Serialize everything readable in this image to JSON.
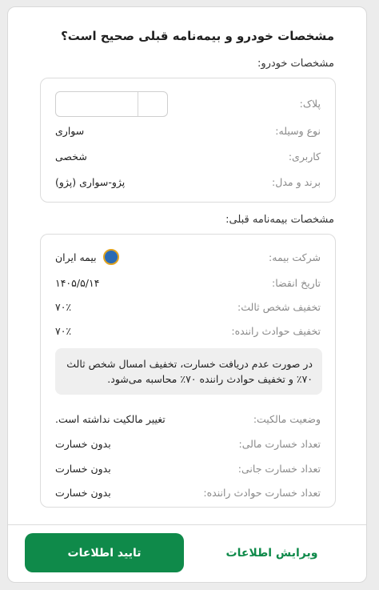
{
  "title": "مشخصات خودرو و بیمه‌نامه قبلی صحیح است؟",
  "vehicle": {
    "section_title": "مشخصات خودرو:",
    "plate_label": "پلاک:",
    "type_label": "نوع وسیله:",
    "type_value": "سواری",
    "usage_label": "کاربری:",
    "usage_value": "شخصی",
    "model_label": "برند و مدل:",
    "model_value": "پژو-سواری (پژو)"
  },
  "insurance": {
    "section_title": "مشخصات بیمه‌نامه قبلی:",
    "company_label": "شرکت بیمه:",
    "company_value": "بیمه ایران",
    "company_logo_icon": "iran-insurance-logo-icon",
    "expiry_label": "تاریخ انقضا:",
    "expiry_value": "۱۴۰۵/۵/۱۴",
    "third_party_discount_label": "تخفیف شخص ثالث:",
    "third_party_discount_value": "۷۰٪",
    "driver_discount_label": "تخفیف حوادث راننده:",
    "driver_discount_value": "۷۰٪",
    "notice": "در صورت عدم دریافت خسارت، تخفیف امسال شخص ثالث ۷۰٪ و تخفیف حوادث راننده ۷۰٪ محاسبه می‌شود.",
    "ownership_label": "وضعیت مالکیت:",
    "ownership_value": "تغییر مالکیت نداشته است.",
    "financial_claims_label": "تعداد خسارت مالی:",
    "financial_claims_value": "بدون خسارت",
    "bodily_claims_label": "تعداد خسارت جانی:",
    "bodily_claims_value": "بدون خسارت",
    "driver_claims_label": "تعداد خسارت حوادث راننده:",
    "driver_claims_value": "بدون خسارت"
  },
  "actions": {
    "confirm_label": "تایید اطلاعات",
    "edit_label": "ویرایش اطلاعات"
  },
  "colors": {
    "accent": "#0f8a4a",
    "notice_bg": "#efefef"
  }
}
